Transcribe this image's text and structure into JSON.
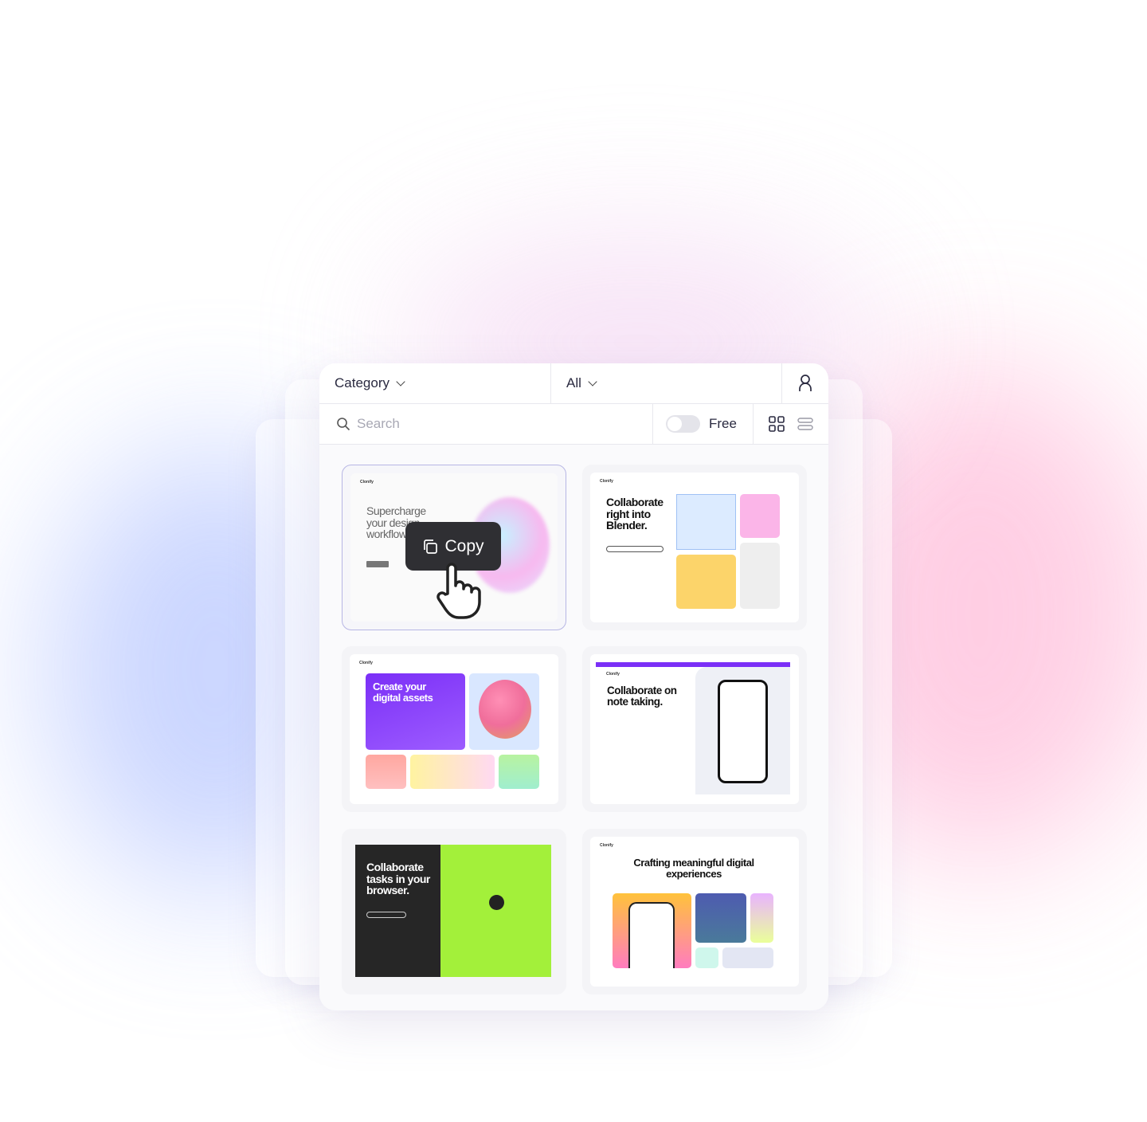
{
  "toolbar": {
    "category_label": "Category",
    "filter_label": "All",
    "search_placeholder": "Search",
    "free_label": "Free",
    "free_toggle_on": false,
    "view_mode": "grid"
  },
  "icons": {
    "user": "user-icon",
    "search": "search-icon",
    "grid": "grid-view-icon",
    "list": "list-view-icon",
    "copy": "copy-icon",
    "cursor": "hand-pointer-icon"
  },
  "tooltip": {
    "label": "Copy"
  },
  "templates": [
    {
      "brand": "Clonify",
      "headline": "Supercharge your design workflow"
    },
    {
      "brand": "Clonify",
      "headline": "Collaborate right into Blender."
    },
    {
      "brand": "Clonify",
      "headline": "Create your digital assets"
    },
    {
      "brand": "Clonify",
      "headline": "Collaborate on note taking."
    },
    {
      "brand": "",
      "headline": "Collaborate tasks in your browser."
    },
    {
      "brand": "Clonify",
      "headline": "Crafting meaningful digital experiences"
    }
  ],
  "colors": {
    "accent_purple": "#7b2ff7",
    "lime": "#a3f03a",
    "tooltip_bg": "#2f2f33",
    "selected_border": "#b7b6e4"
  }
}
